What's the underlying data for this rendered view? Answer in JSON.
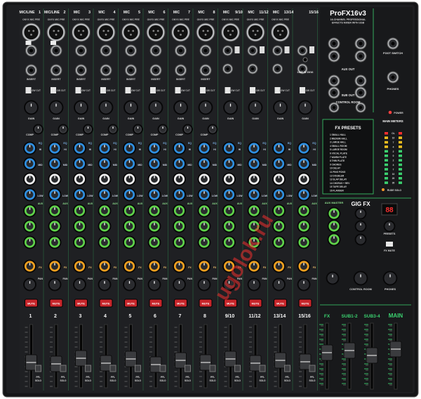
{
  "brand": {
    "name": "ProFX16v3",
    "tagline": [
      "16-CHANNEL PROFESSIONAL",
      "EFFECTS MIXER WITH USB"
    ]
  },
  "channels": [
    {
      "number": "1",
      "top_label": "MIC/LINE",
      "type": "mono"
    },
    {
      "number": "2",
      "top_label": "MIC/LINE",
      "type": "mono"
    },
    {
      "number": "3",
      "top_label": "MIC",
      "type": "mono"
    },
    {
      "number": "4",
      "top_label": "MIC",
      "type": "mono"
    },
    {
      "number": "5",
      "top_label": "MIC",
      "type": "mono"
    },
    {
      "number": "6",
      "top_label": "MIC",
      "type": "mono"
    },
    {
      "number": "7",
      "top_label": "MIC",
      "type": "mono"
    },
    {
      "number": "8",
      "top_label": "MIC",
      "type": "mono"
    },
    {
      "number": "9/10",
      "top_label": "MIC",
      "type": "stereo"
    },
    {
      "number": "11/12",
      "top_label": "MIC",
      "type": "stereo"
    },
    {
      "number": "13/14",
      "top_label": "MIC",
      "type": "stereo"
    },
    {
      "number": "15/16",
      "top_label": "",
      "type": "stereo"
    }
  ],
  "strip_labels": {
    "mic_pre": "ONYX MIC PRE",
    "insert": "INSERT",
    "low_cut": "LOW CUT",
    "comp": "COMP",
    "gain": "GAIN",
    "eq": "EQ",
    "hi": "HI",
    "mid": "MID",
    "low": "LOW",
    "aux": "AUX",
    "fx": "FX",
    "pan": "PAN",
    "mute": "MUTE",
    "pfl": "PFL",
    "solo": "SOLO",
    "line_in": "LINE IN 15/16"
  },
  "master_section": {
    "aux_out": "AUX OUT",
    "sub_out": "SUB OUT",
    "control_room": "CONTROL ROOM",
    "foot_switch": "FOOT SWITCH",
    "phones": "PHONES",
    "power": "POWER",
    "main_meters": "MAIN METERS",
    "fx_presets_title": "FX PRESETS",
    "fx_presets": [
      "SMALL HALL",
      "MEDIUM HALL",
      "LARGE HALL",
      "SMALL ROOM",
      "LARGE ROOM",
      "VOCAL PLATE",
      "WARM PLATE",
      "THIN PLATE",
      "CHORUS",
      "DELAY",
      "PING PONG",
      "DOUBLER",
      "SLAP DELAY",
      "CHORUS + REV",
      "TAPE DELAY",
      "FLANGER"
    ],
    "meter_scale": [
      "OL",
      "10",
      "7",
      "4",
      "2",
      "0",
      "2",
      "4",
      "7",
      "10",
      "20",
      "30"
    ],
    "rude_solo": "RUDE SOLO",
    "aux_master": "AUX MASTER",
    "gig_fx": "GIG FX",
    "fx_display": "88",
    "presets": "PRESETS",
    "fx_mute": "FX MUTE",
    "cr_knob": "CONTROL ROOM",
    "phones_knob": "PHONES"
  },
  "master_faders": [
    {
      "label": "FX"
    },
    {
      "label": "SUB1-2"
    },
    {
      "label": "SUB3-4"
    },
    {
      "label": "MAIN"
    }
  ],
  "watermark": "ugolok.ru",
  "colors": {
    "panel": "#1b1c1e",
    "accent": "#3bd16f",
    "eq_blue": "#2f8fe0",
    "aux_green": "#5fd24a",
    "fx_orange": "#f0a020",
    "mute_red": "#c8262b"
  }
}
